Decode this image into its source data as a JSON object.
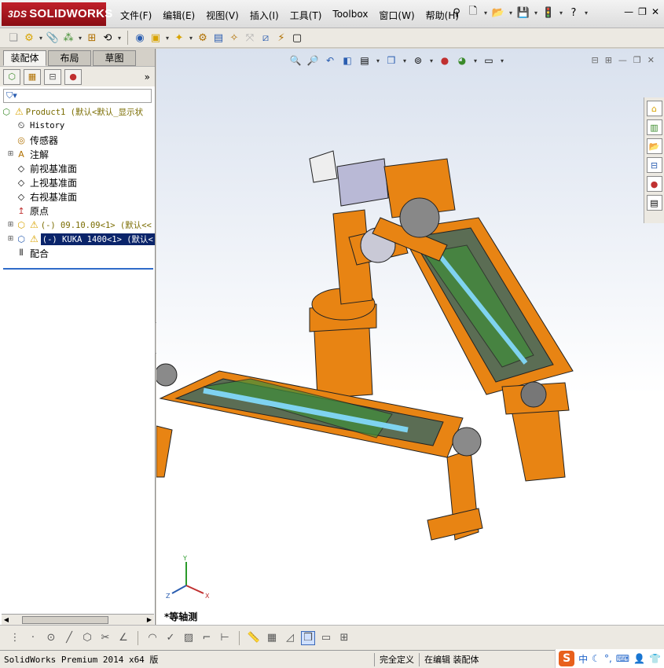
{
  "app": {
    "brand_prefix": "3DS",
    "brand": "SOLIDWORKS",
    "menus": [
      "文件(F)",
      "编辑(E)",
      "视图(V)",
      "插入(I)",
      "工具(T)",
      "Toolbox",
      "窗口(W)",
      "帮助(H)"
    ]
  },
  "colors": {
    "brand_red": "#b3161f",
    "selection_blue": "#0a246a",
    "machine_orange": "#e88413"
  },
  "manager": {
    "tabs": [
      "装配体",
      "布局",
      "草图"
    ],
    "active_tab": "装配体",
    "more": "»"
  },
  "tree": {
    "root": "Product1  (默认<默认_显示状",
    "items": [
      {
        "label": "History",
        "icon": "history-icon"
      },
      {
        "label": "传感器",
        "icon": "sensor-icon"
      },
      {
        "label": "注解",
        "icon": "annotation-icon"
      },
      {
        "label": "前视基准面",
        "icon": "plane-icon"
      },
      {
        "label": "上视基准面",
        "icon": "plane-icon"
      },
      {
        "label": "右视基准面",
        "icon": "plane-icon"
      },
      {
        "label": "原点",
        "icon": "origin-icon"
      },
      {
        "label": "(-) 09.10.09<1> (默认<<",
        "icon": "component-icon"
      },
      {
        "label": "(-) KUKA 1400<1> (默认<",
        "icon": "component-icon"
      },
      {
        "label": "配合",
        "icon": "mates-icon"
      }
    ]
  },
  "viewport": {
    "view_name": "*等轴测",
    "triad_axes": [
      "Y",
      "Z",
      "X"
    ]
  },
  "status": {
    "product": "SolidWorks Premium 2014 x64 版",
    "definition": "完全定义",
    "mode": "在编辑 装配体"
  },
  "ime": {
    "logo": "S",
    "lang": "中"
  }
}
